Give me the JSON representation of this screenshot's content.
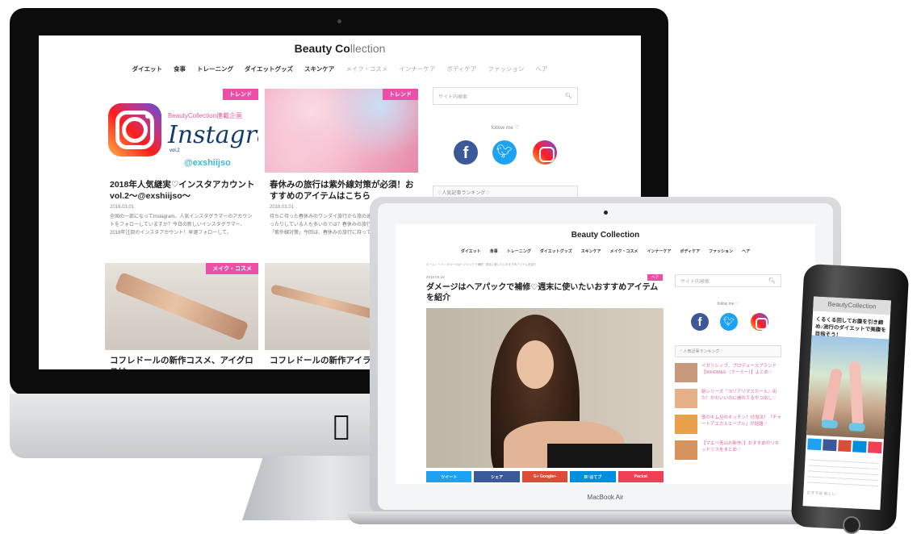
{
  "imac": {
    "site": {
      "logo_bold": "Beauty Co",
      "logo_light": "llection"
    },
    "nav": [
      {
        "label": "ダイエット",
        "dim": false
      },
      {
        "label": "食事",
        "dim": false
      },
      {
        "label": "トレーニング",
        "dim": false
      },
      {
        "label": "ダイエットグッズ",
        "dim": false
      },
      {
        "label": "スキンケア",
        "dim": false
      },
      {
        "label": "メイク・コスメ",
        "dim": true
      },
      {
        "label": "インナーケア",
        "dim": true
      },
      {
        "label": "ボディケア",
        "dim": true
      },
      {
        "label": "ファッション",
        "dim": true
      },
      {
        "label": "ヘア",
        "dim": true
      }
    ],
    "cards": [
      {
        "tag": "トレンド",
        "title": "2018年人気継実♡インスタアカウント vol.2〜@exshiijso〜",
        "date": "2018.03.01",
        "excerpt": "全国の一部になってInstagram。人気インスタグラマーのアカウントをフォローしていますか？今日の新しいインスタグラマー、2018年注目のインスタアカウント！早速フォローして。",
        "ig_top": "BeautyCollection連載企画",
        "ig_script": "Instagram",
        "ig_vol": "vol.2",
        "ig_handle": "@exshiijso"
      },
      {
        "tag": "トレンド",
        "title": "春休みの旅行は紫外線対策が必須！おすすめのアイテムはこちら",
        "date": "2018.03.01",
        "excerpt": "待ちに待った春休みのワンダイ旅行から旅の途中、日焼け止めを塗ったりしている人も多いのでは？春休みの旅行で活躍したいのが「紫外線対策」今回は、春休みの旅行に持って行きたいおすすめ"
      },
      {
        "tag": "メイク・コスメ",
        "title": "コフレドールの新作コスメ、アイグロスは",
        "date": "",
        "excerpt": ""
      },
      {
        "tag": "",
        "title": "コフレドールの新作アイライナ",
        "date": "",
        "excerpt": ""
      }
    ],
    "sidebar": {
      "search_placeholder": "サイト内検索",
      "follow": "follow me ♡",
      "ranking_head": "♡人気記事ランキング♡"
    }
  },
  "macbook": {
    "label": "MacBook Air",
    "site": {
      "logo": "Beauty Collection"
    },
    "nav": [
      "ダイエット",
      "食事",
      "トレーニング",
      "ダイエットグッズ",
      "スキンケア",
      "メイク・コスメ",
      "インナーケア",
      "ボディケア",
      "ファッション",
      "ヘア"
    ],
    "breadcrumb": "ホーム > ヘア > ダメージはヘアパックで補修♡週末に使いたいおすすめアイテムを紹介",
    "article": {
      "date": "2018.03.16",
      "tag": "ヘア",
      "title": "ダメージはヘアパックで補修♡週末に使いたいおすすめアイテムを紹介"
    },
    "share": [
      "ツイート",
      "シェア",
      "G+ Google+",
      "B! はてブ",
      "Pocket"
    ],
    "share_colors": [
      "#1da1f2",
      "#3b5998",
      "#dd4b39",
      "#008fde",
      "#ef4056"
    ],
    "sidebar": {
      "search_placeholder": "サイト内検索",
      "follow": "follow me ♡",
      "ranking_head": "♡人気記事ランキング♡",
      "ranking": [
        "イガリシノブ、プロデュースブランド【WHOMEE（フーミー）】よとめ♡",
        "新シリーズ『ヨリアリマスカール』出た！かわいいのに崩れてるやつ出し♡",
        "夜のキム旦のキッチン！付加法！「チャートアエカルエーブル」が話題♡",
        "【マエベ青山お新作♪】おすすめのリキッドリスをまとめ♡"
      ]
    }
  },
  "iphone": {
    "logo": "BeautyCollection",
    "headline": "くるくる回してお腹を引き締め♪流行のダイエットで美腹を目指そう！",
    "footer": "おすすめ 新しい"
  },
  "colors": {
    "accent": "#ec4fa7",
    "pink_text": "#e0609e"
  }
}
